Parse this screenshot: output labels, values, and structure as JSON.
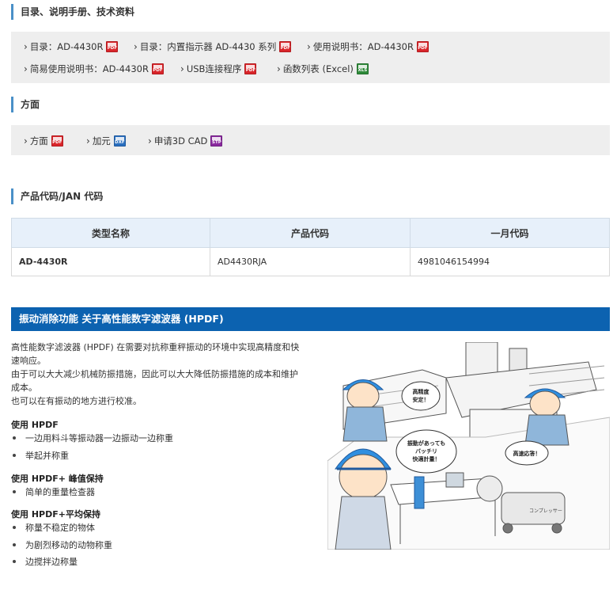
{
  "sections": {
    "catalog_title": "目录、说明手册、技术资料",
    "drawing_title": "方面",
    "code_title": "产品代码/JAN 代码"
  },
  "catalog_links": [
    {
      "label": "目录：AD-4430R",
      "badge": "PDF"
    },
    {
      "label": "目录：内置指示器 AD-4430 系列",
      "badge": "PDF"
    },
    {
      "label": "使用说明书：AD-4430R",
      "badge": "PDF"
    },
    {
      "label": "简易使用说明书：AD-4430R",
      "badge": "PDF"
    },
    {
      "label": "USB连接程序",
      "badge": "PDF"
    },
    {
      "label": "函数列表 (Excel)",
      "badge": "XLS"
    }
  ],
  "drawing_links": [
    {
      "label": "方面",
      "badge": "PDF"
    },
    {
      "label": "加元",
      "badge": "DXF"
    },
    {
      "label": "申请3D CAD",
      "badge": "STP"
    }
  ],
  "code_table": {
    "headers": [
      "类型名称",
      "产品代码",
      "一月代码"
    ],
    "row": [
      "AD-4430R",
      "AD4430RJA",
      "4981046154994"
    ]
  },
  "hpdf": {
    "bar_title": "振动消除功能 关于高性能数字滤波器 (HPDF)",
    "intro": [
      "高性能数字滤波器 (HPDF) 在需要对抗称重秤振动的环境中实现高精度和快",
      "速响应。",
      "由于可以大大减少机械防振措施，因此可以大大降低防振措施的成本和维护",
      "成本。",
      "也可以在有振动的地方进行校准。"
    ],
    "use_hpdf": {
      "title": "使用 HPDF",
      "items": [
        "一边用料斗等振动器一边振动一边称重",
        "举起并称重"
      ]
    },
    "use_peak": {
      "title": "使用 HPDF+ 峰值保持",
      "items": [
        "简单的重量检查器"
      ]
    },
    "use_avg": {
      "title": "使用 HPDF+平均保持",
      "items": [
        "称量不稳定的物体",
        "为剧烈移动的动物称重",
        "边搅拌边称量"
      ]
    }
  },
  "illustration": {
    "bubble1": [
      "高精度",
      "安定！"
    ],
    "bubble2": [
      "振動があっても",
      "バッチリ",
      "快適計量！"
    ],
    "bubble3": [
      "高速応答！"
    ],
    "machine_label": "コンプレッサー"
  },
  "colors": {
    "accent": "#0c62b0",
    "section_bar": "#4a90c8",
    "table_header": "#e7f0fa",
    "pdf_badge": "#d9262b"
  }
}
